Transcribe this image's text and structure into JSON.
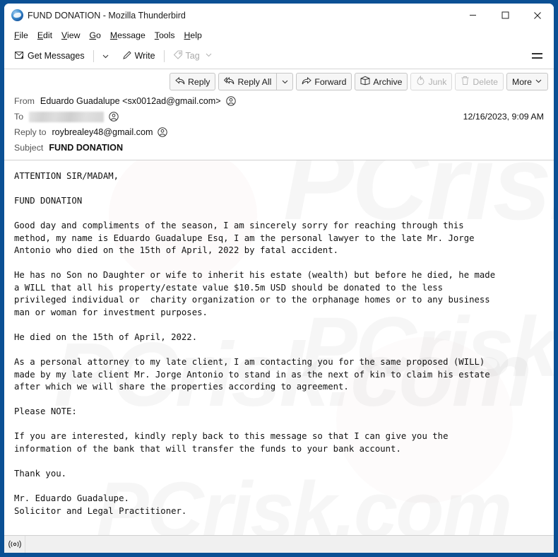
{
  "window": {
    "title": "FUND DONATION - Mozilla Thunderbird",
    "app_icon": "thunderbird-icon",
    "controls": {
      "minimize": "minimize-icon",
      "maximize": "maximize-icon",
      "close": "close-icon"
    },
    "frame_color": "#0b5094"
  },
  "menubar": {
    "items": [
      {
        "label": "File",
        "accesskey": "F"
      },
      {
        "label": "Edit",
        "accesskey": "E"
      },
      {
        "label": "View",
        "accesskey": "V"
      },
      {
        "label": "Go",
        "accesskey": "G"
      },
      {
        "label": "Message",
        "accesskey": "M"
      },
      {
        "label": "Tools",
        "accesskey": "T"
      },
      {
        "label": "Help",
        "accesskey": "H"
      }
    ]
  },
  "toolbar": {
    "get_messages_label": "Get Messages",
    "get_messages_icon": "envelope-download-icon",
    "get_messages_caret": "chevron-down-icon",
    "write_label": "Write",
    "write_icon": "pencil-icon",
    "tag_label": "Tag",
    "tag_icon": "tag-icon",
    "tag_caret": "chevron-down-icon",
    "tag_disabled": true,
    "app_menu_icon": "hamburger-menu-icon"
  },
  "message_actions": {
    "reply_label": "Reply",
    "reply_icon": "reply-arrow-icon",
    "reply_all_label": "Reply All",
    "reply_all_icon": "reply-all-arrow-icon",
    "reply_all_caret": "chevron-down-icon",
    "forward_label": "Forward",
    "forward_icon": "forward-arrow-icon",
    "archive_label": "Archive",
    "archive_icon": "archive-box-icon",
    "junk_label": "Junk",
    "junk_icon": "flame-icon",
    "junk_disabled": true,
    "delete_label": "Delete",
    "delete_icon": "trash-icon",
    "delete_disabled": true,
    "more_label": "More",
    "more_caret": "chevron-down-icon"
  },
  "message_header": {
    "from_label": "From",
    "from_value": "Eduardo Guadalupe <sx0012ad@gmail.com>",
    "to_label": "To",
    "to_value": "",
    "to_redacted": true,
    "reply_to_label": "Reply to",
    "reply_to_value": "roybrealey48@gmail.com",
    "subject_label": "Subject",
    "subject_value": "FUND DONATION",
    "date": "12/16/2023, 9:09 AM",
    "contact_icon": "contact-avatar-icon"
  },
  "message_body": {
    "text": "ATTENTION SIR/MADAM,\n\nFUND DONATION\n\nGood day and compliments of the season, I am sincerely sorry for reaching through this\nmethod, my name is Eduardo Guadalupe Esq, I am the personal lawyer to the late Mr. Jorge\nAntonio who died on the 15th of April, 2022 by fatal accident.\n\nHe has no Son no Daughter or wife to inherit his estate (wealth) but before he died, he made\na WILL that all his property/estate value $10.5m USD should be donated to the less\nprivileged individual or  charity organization or to the orphanage homes or to any business\nman or woman for investment purposes.\n\nHe died on the 15th of April, 2022.\n\nAs a personal attorney to my late client, I am contacting you for the same proposed (WILL)\nmade by my late client Mr. Jorge Antonio to stand in as the next of kin to claim his estate\nafter which we will share the properties according to agreement.\n\nPlease NOTE:\n\nIf you are interested, kindly reply back to this message so that I can give you the\ninformation of the bank that will transfer the funds to your bank account.\n\nThank you.\n\nMr. Eduardo Guadalupe.\nSolicitor and Legal Practitioner.",
    "watermark_text": "PCrisk.com"
  },
  "statusbar": {
    "connection_icon": "online-status-icon",
    "text": ""
  }
}
